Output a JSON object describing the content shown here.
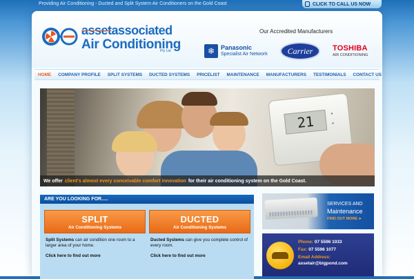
{
  "topbar": {
    "tagline": "Providing Air Conditioning - Ducted and Split System Air Conditioners on the Gold Coast",
    "call_label": "CLICK TO CALL US NOW"
  },
  "logo": {
    "line1_a": "asset",
    "line1_b": "associated",
    "line2": "Air Conditioning",
    "pty": "Pty Ltd"
  },
  "manufacturers": {
    "title": "Our Accredited Manufacturers",
    "panasonic": "Panasonic",
    "panasonic_sub": "Specialist Air Network",
    "carrier": "Carrier",
    "toshiba": "TOSHIBA",
    "toshiba_sub": "AIR CONDITIONING"
  },
  "nav": {
    "items": [
      "HOME",
      "COMPANY PROFILE",
      "SPLIT SYSTEMS",
      "DUCTED SYSTEMS",
      "PRICELIST",
      "MAINTENANCE",
      "MANUFACTURERS",
      "TESTIMONIALS",
      "CONTACT US"
    ],
    "active": "HOME"
  },
  "hero": {
    "thermostat_reading": "21",
    "caption_pre": "We offer",
    "caption_highlight": "client's almost every conceivable comfort innovation",
    "caption_post": "for their air conditioning system on the Gold Coast."
  },
  "looking": {
    "heading": "ARE YOU LOOKING FOR.....",
    "split": {
      "title": "SPLIT",
      "subtitle": "Air Conditioning Systems",
      "bold": "Split Systems",
      "desc": " can air condition one room to a larger area of your home.",
      "link": "Click here to find out more"
    },
    "ducted": {
      "title": "DUCTED",
      "subtitle": "Air Conditioning Systems",
      "bold": "Ducted Systems",
      "desc": " can give you complete control of every room.",
      "link": "Click here to find out more"
    }
  },
  "services": {
    "line1": "SERVICES AND",
    "line2": "Maintenance",
    "link": "FIND OUT MORE ►"
  },
  "contact": {
    "phone_label": "Phone:",
    "phone": "07 5596 1033",
    "fax_label": "Fax:",
    "fax": "07 5596 1077",
    "email_label": "Email Address:",
    "email": "assetair@bigpond.com"
  },
  "colors": {
    "brand_blue": "#1b6cbf",
    "accent_orange": "#ea6a16",
    "nav_active": "#e95d18"
  }
}
